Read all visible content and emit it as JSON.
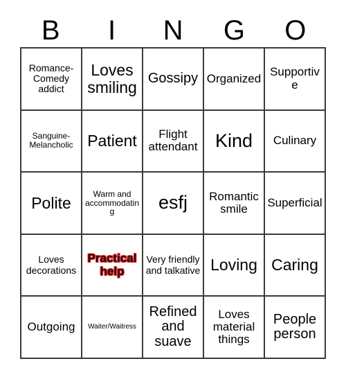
{
  "card": {
    "title_letters": [
      "B",
      "I",
      "N",
      "G",
      "O"
    ],
    "grid_columns": 5,
    "grid_rows": 5,
    "border_color": "#3a3a3a",
    "background_color": "#ffffff",
    "text_color": "#000000",
    "highlight_text_color": "#2b0000",
    "highlight_glow_color": "#e23b3b"
  },
  "cells": [
    {
      "text": "Romance-Comedy addict",
      "size": "fs-sm",
      "highlighted": false
    },
    {
      "text": "Loves smiling",
      "size": "fs-xl",
      "highlighted": false
    },
    {
      "text": "Gossipy",
      "size": "fs-lg",
      "highlighted": false
    },
    {
      "text": "Organized",
      "size": "fs-md",
      "highlighted": false
    },
    {
      "text": "Supportive",
      "size": "fs-md",
      "highlighted": false
    },
    {
      "text": "Sanguine-Melancholic",
      "size": "fs-xs",
      "highlighted": false
    },
    {
      "text": "Patient",
      "size": "fs-xl",
      "highlighted": false
    },
    {
      "text": "Flight attendant",
      "size": "fs-md",
      "highlighted": false
    },
    {
      "text": "Kind",
      "size": "fs-xxl",
      "highlighted": false
    },
    {
      "text": "Culinary",
      "size": "fs-md",
      "highlighted": false
    },
    {
      "text": "Polite",
      "size": "fs-xl",
      "highlighted": false
    },
    {
      "text": "Warm and accommodating",
      "size": "fs-xs",
      "highlighted": false
    },
    {
      "text": "esfj",
      "size": "fs-xxl",
      "highlighted": false
    },
    {
      "text": "Romantic smile",
      "size": "fs-md",
      "highlighted": false
    },
    {
      "text": "Superficial",
      "size": "fs-md",
      "highlighted": false
    },
    {
      "text": "Loves decorations",
      "size": "fs-sm",
      "highlighted": false
    },
    {
      "text": "Practical help",
      "size": "fs-md",
      "highlighted": true
    },
    {
      "text": "Very friendly and talkative",
      "size": "fs-sm",
      "highlighted": false
    },
    {
      "text": "Loving",
      "size": "fs-xl",
      "highlighted": false
    },
    {
      "text": "Caring",
      "size": "fs-xl",
      "highlighted": false
    },
    {
      "text": "Outgoing",
      "size": "fs-md",
      "highlighted": false
    },
    {
      "text": "Waiter/Waitress",
      "size": "fs-xxs",
      "highlighted": false
    },
    {
      "text": "Refined and suave",
      "size": "fs-lg",
      "highlighted": false
    },
    {
      "text": "Loves material things",
      "size": "fs-md",
      "highlighted": false
    },
    {
      "text": "People person",
      "size": "fs-lg",
      "highlighted": false
    }
  ]
}
